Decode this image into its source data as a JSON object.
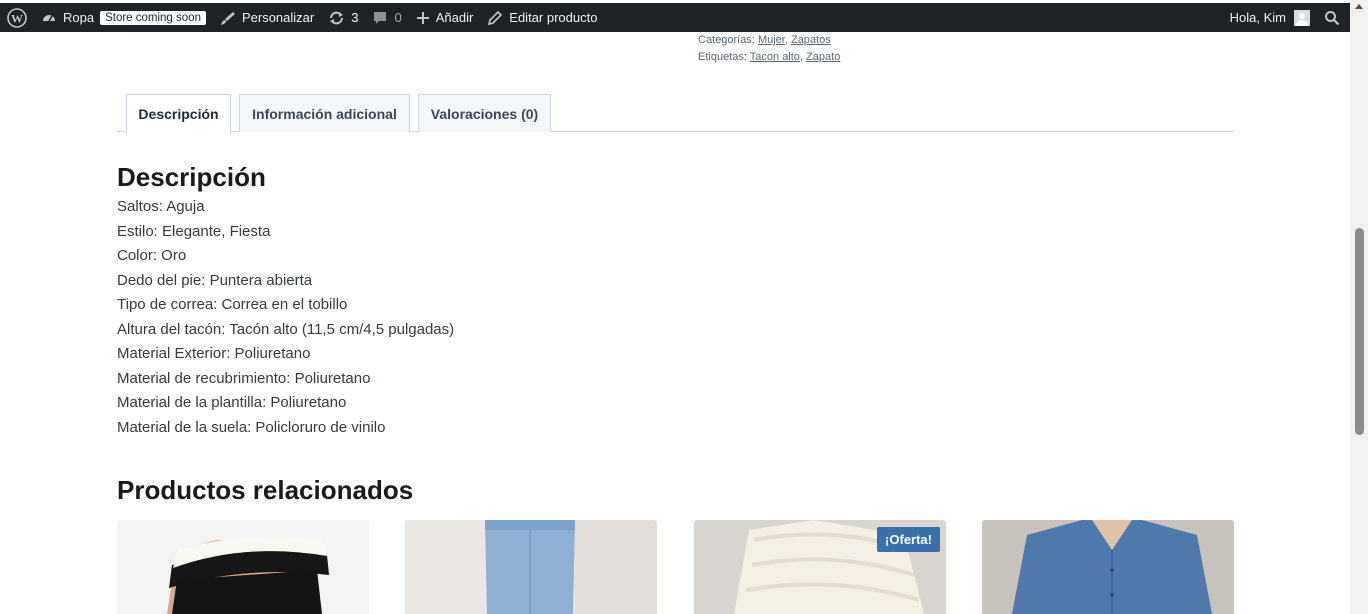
{
  "adminbar": {
    "site_name": "Ropa",
    "store_badge": "Store coming soon",
    "customize": "Personalizar",
    "updates_count": "3",
    "comments_count": "0",
    "add_new": "Añadir",
    "edit_product": "Editar producto",
    "greeting": "Hola, Kim"
  },
  "meta": {
    "categories_label": "Categorías:",
    "categories": [
      "Mujer",
      "Zapatos"
    ],
    "tags_label": "Etiquetas:",
    "tags": [
      "Tacon alto",
      "Zapato"
    ]
  },
  "tabs": [
    {
      "label": "Descripción",
      "active": true
    },
    {
      "label": "Información adicional",
      "active": false
    },
    {
      "label": "Valoraciones (0)",
      "active": false
    }
  ],
  "description": {
    "heading": "Descripción",
    "lines": [
      "Saltos: Aguja",
      "Estilo: Elegante, Fiesta",
      "Color: Oro",
      "Dedo del pie: Puntera abierta",
      "Tipo de correa: Correa en el tobillo",
      "Altura del tacón: Tacón alto (11,5 cm/4,5 pulgadas)",
      "Material Exterior: Poliuretano",
      "Material de recubrimiento: Poliuretano",
      "Material de la plantilla: Poliuretano",
      "Material de la suela: Policloruro de vinilo"
    ]
  },
  "related": {
    "heading": "Productos relacionados",
    "sale_badge": "¡Oferta!"
  },
  "colors": {
    "adminbar_bg": "#1d2327",
    "sale_badge_bg": "#3971ac",
    "tab_border": "#cfd6dd"
  }
}
